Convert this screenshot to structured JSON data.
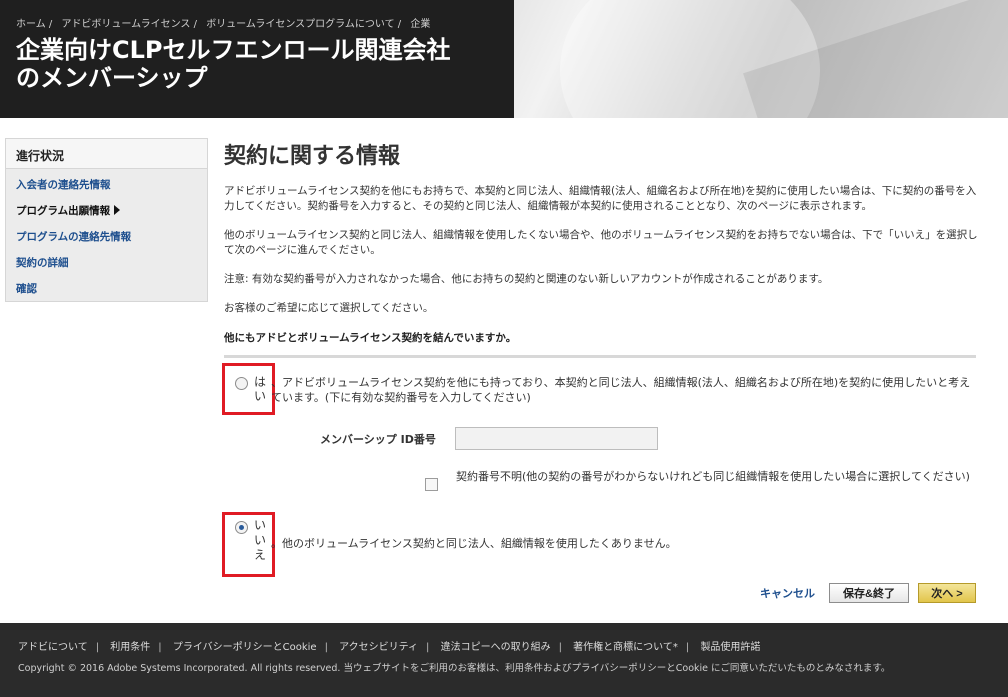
{
  "header": {
    "breadcrumb": [
      "ホーム /",
      "アドビボリュームライセンス /",
      "ボリュームライセンスプログラムについて /",
      "企業"
    ],
    "title_line1": "企業向けCLPセルフエンロール関連会社",
    "title_line2": "のメンバーシップ"
  },
  "sidebar": {
    "heading": "進行状況",
    "items": [
      {
        "label": "入会者の連絡先情報"
      },
      {
        "label": "プログラム出願情報"
      },
      {
        "label": "プログラムの連絡先情報"
      },
      {
        "label": "契約の詳細"
      },
      {
        "label": "確認"
      }
    ]
  },
  "main": {
    "heading": "契約に関する情報",
    "paragraphs": [
      "アドビボリュームライセンス契約を他にもお持ちで、本契約と同じ法人、組織情報(法人、組織名および所在地)を契約に使用したい場合は、下に契約の番号を入力してください。契約番号を入力すると、その契約と同じ法人、組織情報が本契約に使用されることとなり、次のページに表示されます。",
      "他のボリュームライセンス契約と同じ法人、組織情報を使用したくない場合や、他のボリュームライセンス契約をお持ちでない場合は、下で「いいえ」を選択して次のページに進んでください。",
      "注意: 有効な契約番号が入力されなかった場合、他にお持ちの契約と関連のない新しいアカウントが作成されることがあります。",
      "お客様のご希望に応じて選択してください。"
    ],
    "question": "他にもアドビとボリュームライセンス契約を結んでいますか。",
    "option_yes_label": "はい",
    "option_yes_text": "、アドビボリュームライセンス契約を他にも持っており、本契約と同じ法人、組織情報(法人、組織名および所在地)を契約に使用したいと考えています。(下に有効な契約番号を入力してください)",
    "membership_label": "メンバーシップ ID番号",
    "membership_value": "",
    "unknown_checkbox_label": "契約番号不明(他の契約の番号がわからないけれども同じ組織情報を使用したい場合に選択してください)",
    "option_no_label": "いいえ",
    "option_no_text": "。他のボリュームライセンス契約と同じ法人、組織情報を使用したくありません。",
    "selected_option": "no"
  },
  "buttons": {
    "cancel": "キャンセル",
    "save_exit": "保存&終了",
    "next": "次へ >"
  },
  "footer": {
    "links": [
      "アドビについて",
      "利用条件",
      "プライバシーポリシーとCookie",
      "アクセシビリティ",
      "違法コピーへの取り組み",
      "著作権と商標について*",
      "製品使用許諾"
    ],
    "copyright": "Copyright © 2016 Adobe Systems Incorporated. All rights reserved. 当ウェブサイトをご利用のお客様は、利用条件およびプライバシーポリシーとCookie にご同意いただいたものとみなされます。"
  },
  "colors": {
    "link": "#1e4f8e",
    "highlight": "#e01b24",
    "next_button": "#e2c54b",
    "header_dark": "#1f1f1f",
    "footer_bg": "#2b2b2b"
  }
}
